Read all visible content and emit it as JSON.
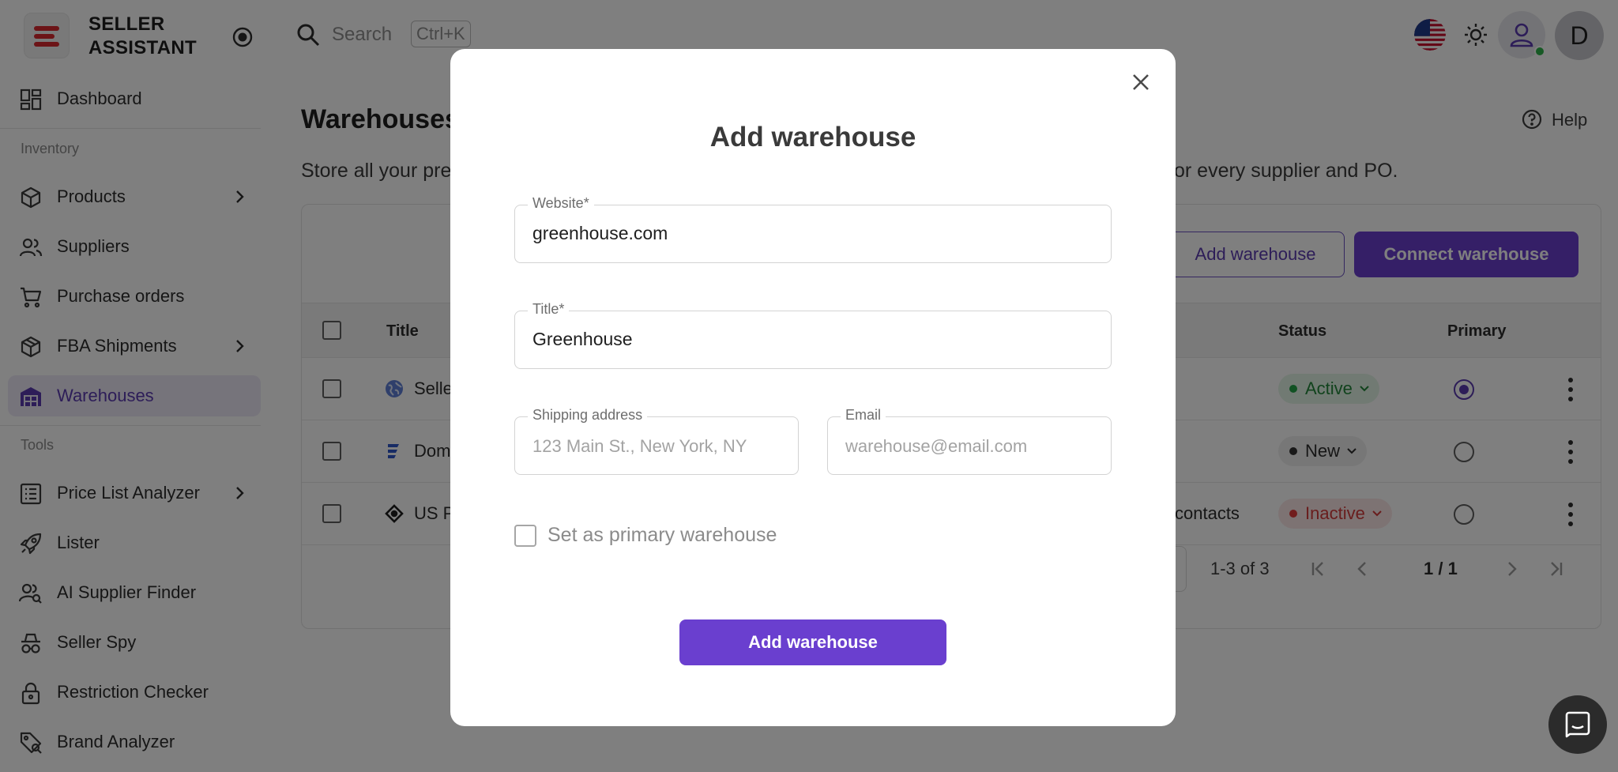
{
  "app": {
    "brand_line1": "SELLER",
    "brand_line2": "ASSISTANT",
    "brand_color": "#d8292f",
    "accent": "#6a3fcf"
  },
  "header": {
    "search_placeholder": "Search",
    "search_shortcut": "Ctrl+K",
    "avatar_initial": "D",
    "icons": [
      "search-icon",
      "us-flag-icon",
      "theme-icon",
      "user-icon"
    ]
  },
  "sidebar": {
    "dashboard": "Dashboard",
    "section_inventory": "Inventory",
    "products": "Products",
    "suppliers": "Suppliers",
    "purchase_orders": "Purchase orders",
    "fba_shipments": "FBA Shipments",
    "warehouses": "Warehouses",
    "section_tools": "Tools",
    "price_list_analyzer": "Price List Analyzer",
    "lister": "Lister",
    "ai_supplier_finder": "AI Supplier Finder",
    "seller_spy": "Seller Spy",
    "restriction_checker": "Restriction Checker",
    "brand_analyzer": "Brand Analyzer"
  },
  "main": {
    "title": "Warehouses",
    "help": "Help",
    "description_start": "Store all your pre",
    "description_end": "or every supplier and PO.",
    "add_warehouse": "Add warehouse",
    "connect_warehouse": "Connect warehouse",
    "columns": {
      "title": "Title",
      "status": "Status",
      "primary": "Primary"
    },
    "rows": [
      {
        "title": "Selle",
        "extra": "",
        "status": "Active",
        "primary": true
      },
      {
        "title": "Dom",
        "extra": "",
        "status": "New",
        "primary": false
      },
      {
        "title": "US P",
        "extra": "contacts",
        "status": "Inactive",
        "primary": false
      }
    ],
    "pagination": {
      "range": "1-3 of 3",
      "page": "1 / 1"
    }
  },
  "modal": {
    "title": "Add warehouse",
    "website_label": "Website*",
    "website_value": "greenhouse.com",
    "title_label": "Title*",
    "title_value": "Greenhouse",
    "address_label": "Shipping address",
    "address_placeholder": "123 Main St., New York, NY",
    "email_label": "Email",
    "email_placeholder": "warehouse@email.com",
    "primary_checkbox": "Set as primary warehouse",
    "primary_checked": false,
    "submit": "Add warehouse"
  }
}
